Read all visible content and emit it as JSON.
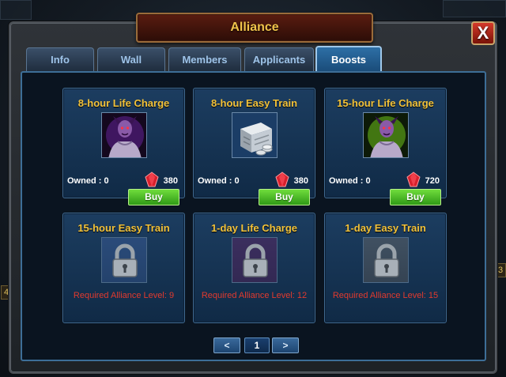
{
  "window": {
    "title": "Alliance",
    "close_label": "X"
  },
  "tabs": [
    {
      "label": "Info",
      "active": false
    },
    {
      "label": "Wall",
      "active": false
    },
    {
      "label": "Members",
      "active": false
    },
    {
      "label": "Applicants",
      "active": false
    },
    {
      "label": "Boosts",
      "active": true
    }
  ],
  "boosts": [
    {
      "title": "8-hour Life Charge",
      "icon": "purple-demon-portrait",
      "owned": "Owned : 0",
      "price": "380",
      "buy_label": "Buy"
    },
    {
      "title": "8-hour Easy Train",
      "icon": "silver-coin-crate",
      "owned": "Owned : 0",
      "price": "380",
      "buy_label": "Buy"
    },
    {
      "title": "15-hour Life Charge",
      "icon": "green-demon-portrait",
      "owned": "Owned : 0",
      "price": "720",
      "buy_label": "Buy"
    }
  ],
  "locked_boosts": [
    {
      "title": "15-hour Easy Train",
      "requirement": "Required Alliance Level: 9",
      "icon": "padlock-icon"
    },
    {
      "title": "1-day Life Charge",
      "requirement": "Required Alliance Level: 12",
      "icon": "padlock-icon"
    },
    {
      "title": "1-day Easy Train",
      "requirement": "Required Alliance Level: 15",
      "icon": "padlock-icon"
    }
  ],
  "pagination": {
    "prev_label": "<",
    "current_page": "1",
    "next_label": ">"
  },
  "side_numbers": {
    "left": "4",
    "right": "3"
  },
  "colors": {
    "title_gold": "#f2c23a",
    "buy_green": "#3fae1e",
    "requirement_red": "#e23a2e",
    "gem_red": "#d8202c"
  }
}
